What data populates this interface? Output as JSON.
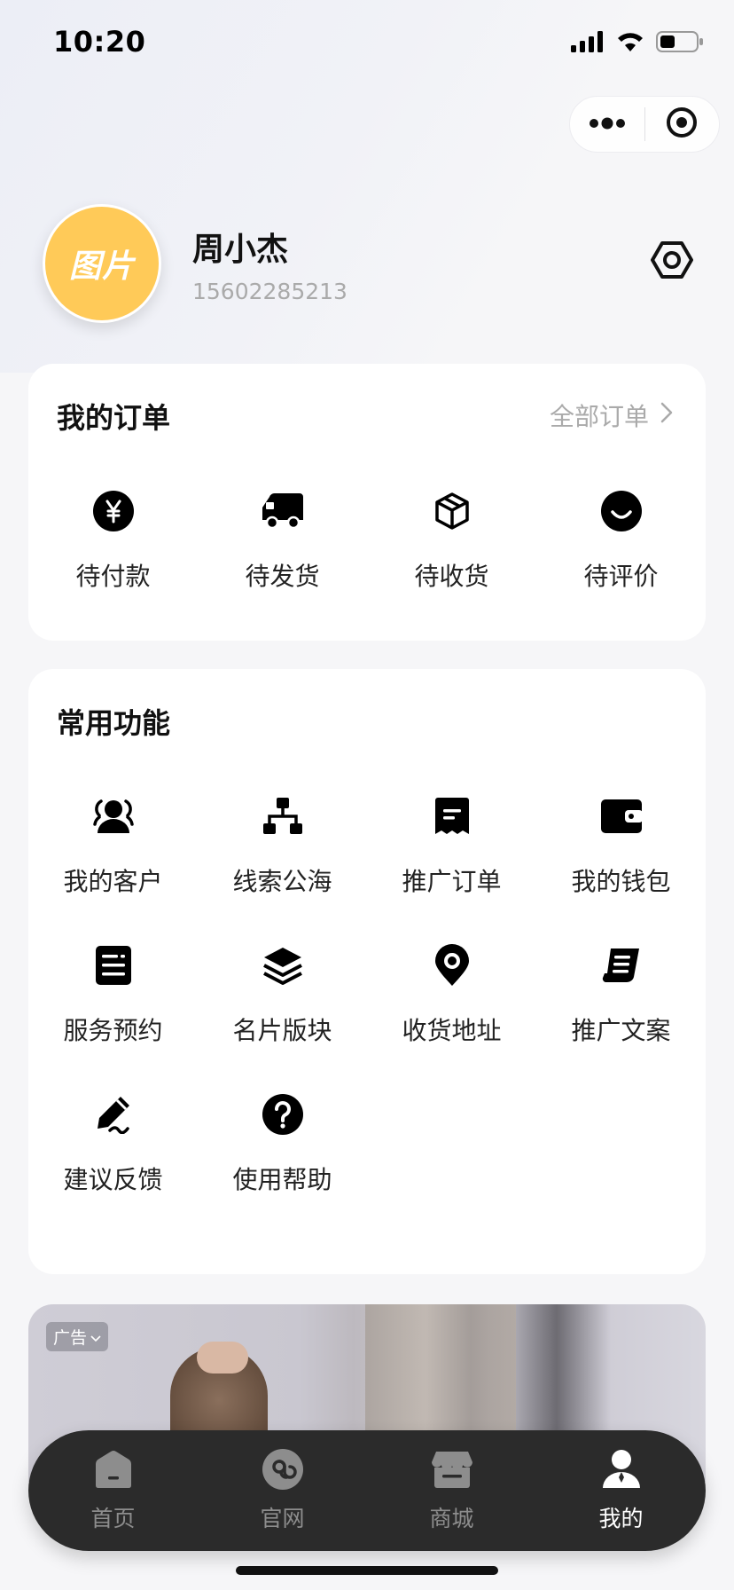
{
  "status_bar": {
    "time": "10:20"
  },
  "profile": {
    "avatar_text": "图片",
    "name": "周小杰",
    "phone": "15602285213"
  },
  "orders": {
    "title": "我的订单",
    "all_link": "全部订单",
    "items": [
      {
        "label": "待付款",
        "icon": "yen-icon"
      },
      {
        "label": "待发货",
        "icon": "truck-icon"
      },
      {
        "label": "待收货",
        "icon": "package-icon"
      },
      {
        "label": "待评价",
        "icon": "smile-icon"
      }
    ]
  },
  "functions": {
    "title": "常用功能",
    "items": [
      {
        "label": "我的客户",
        "icon": "customers-icon"
      },
      {
        "label": "线索公海",
        "icon": "hierarchy-icon"
      },
      {
        "label": "推广订单",
        "icon": "receipt-icon"
      },
      {
        "label": "我的钱包",
        "icon": "wallet-icon"
      },
      {
        "label": "服务预约",
        "icon": "notes-icon"
      },
      {
        "label": "名片版块",
        "icon": "layers-icon"
      },
      {
        "label": "收货地址",
        "icon": "location-pin-icon"
      },
      {
        "label": "推广文案",
        "icon": "scroll-icon"
      },
      {
        "label": "建议反馈",
        "icon": "pen-icon"
      },
      {
        "label": "使用帮助",
        "icon": "help-icon"
      }
    ]
  },
  "ad": {
    "badge": "广告"
  },
  "tabbar": {
    "items": [
      {
        "label": "首页",
        "icon": "home-icon",
        "active": false
      },
      {
        "label": "官网",
        "icon": "link-icon",
        "active": false
      },
      {
        "label": "商城",
        "icon": "store-icon",
        "active": false
      },
      {
        "label": "我的",
        "icon": "user-icon",
        "active": true
      }
    ]
  },
  "colors": {
    "avatar_bg": "#ffca58",
    "tabbar_bg": "#2b2b2b",
    "tab_active": "#ffffff",
    "tab_inactive": "#8d8d8d"
  }
}
